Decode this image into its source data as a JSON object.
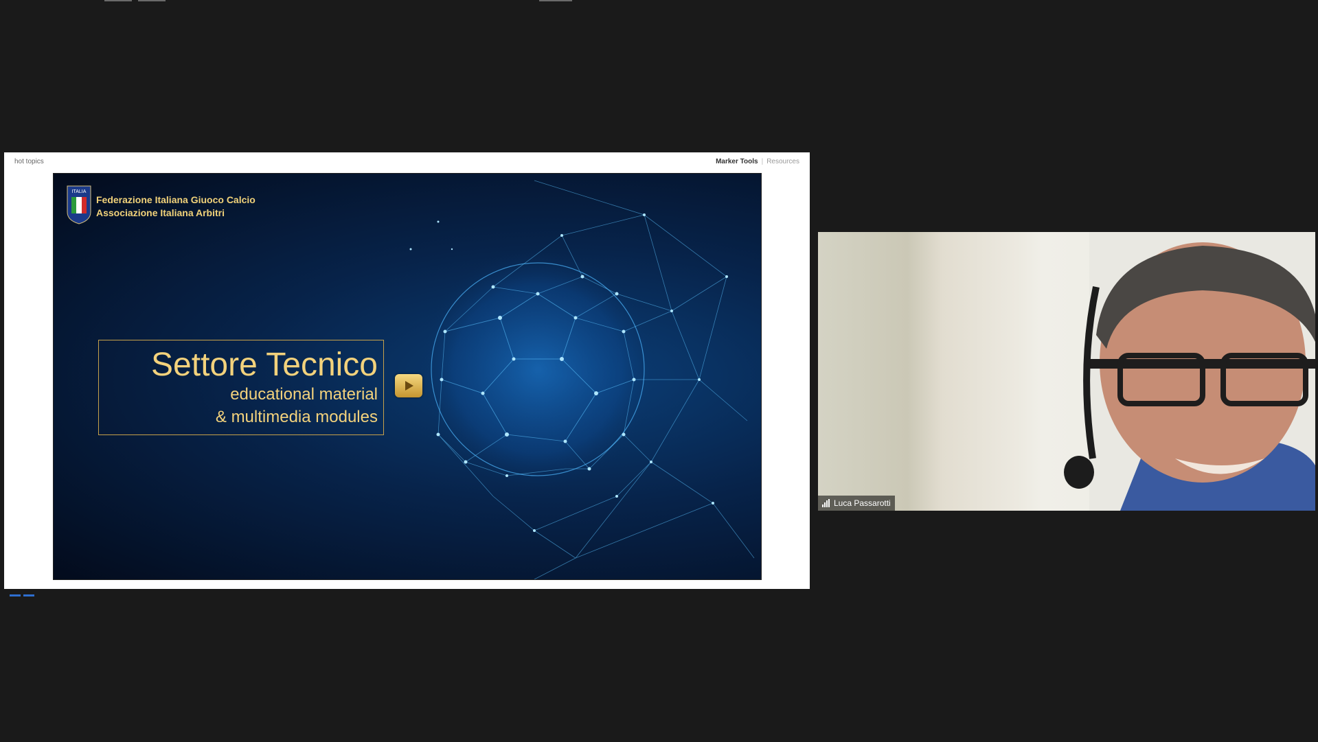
{
  "share": {
    "header_left": "hot topics",
    "header_right_active": "Marker Tools",
    "header_right_muted": "Resources"
  },
  "slide": {
    "org_line1": "Federazione Italiana Giuoco Calcio",
    "org_line2": "Associazione Italiana Arbitri",
    "logo_text": "ITALIA",
    "title": "Settore Tecnico",
    "subtitle_line1": "educational material",
    "subtitle_line2": "& multimedia modules"
  },
  "video": {
    "participant_name": "Luca Passarotti"
  },
  "icons": {
    "play": "play-icon",
    "signal": "signal-icon",
    "logo": "figc-shield-icon"
  },
  "colors": {
    "background": "#1a1a1a",
    "slide_gold": "#f3d27c",
    "slide_blue": "#0b3f78"
  }
}
